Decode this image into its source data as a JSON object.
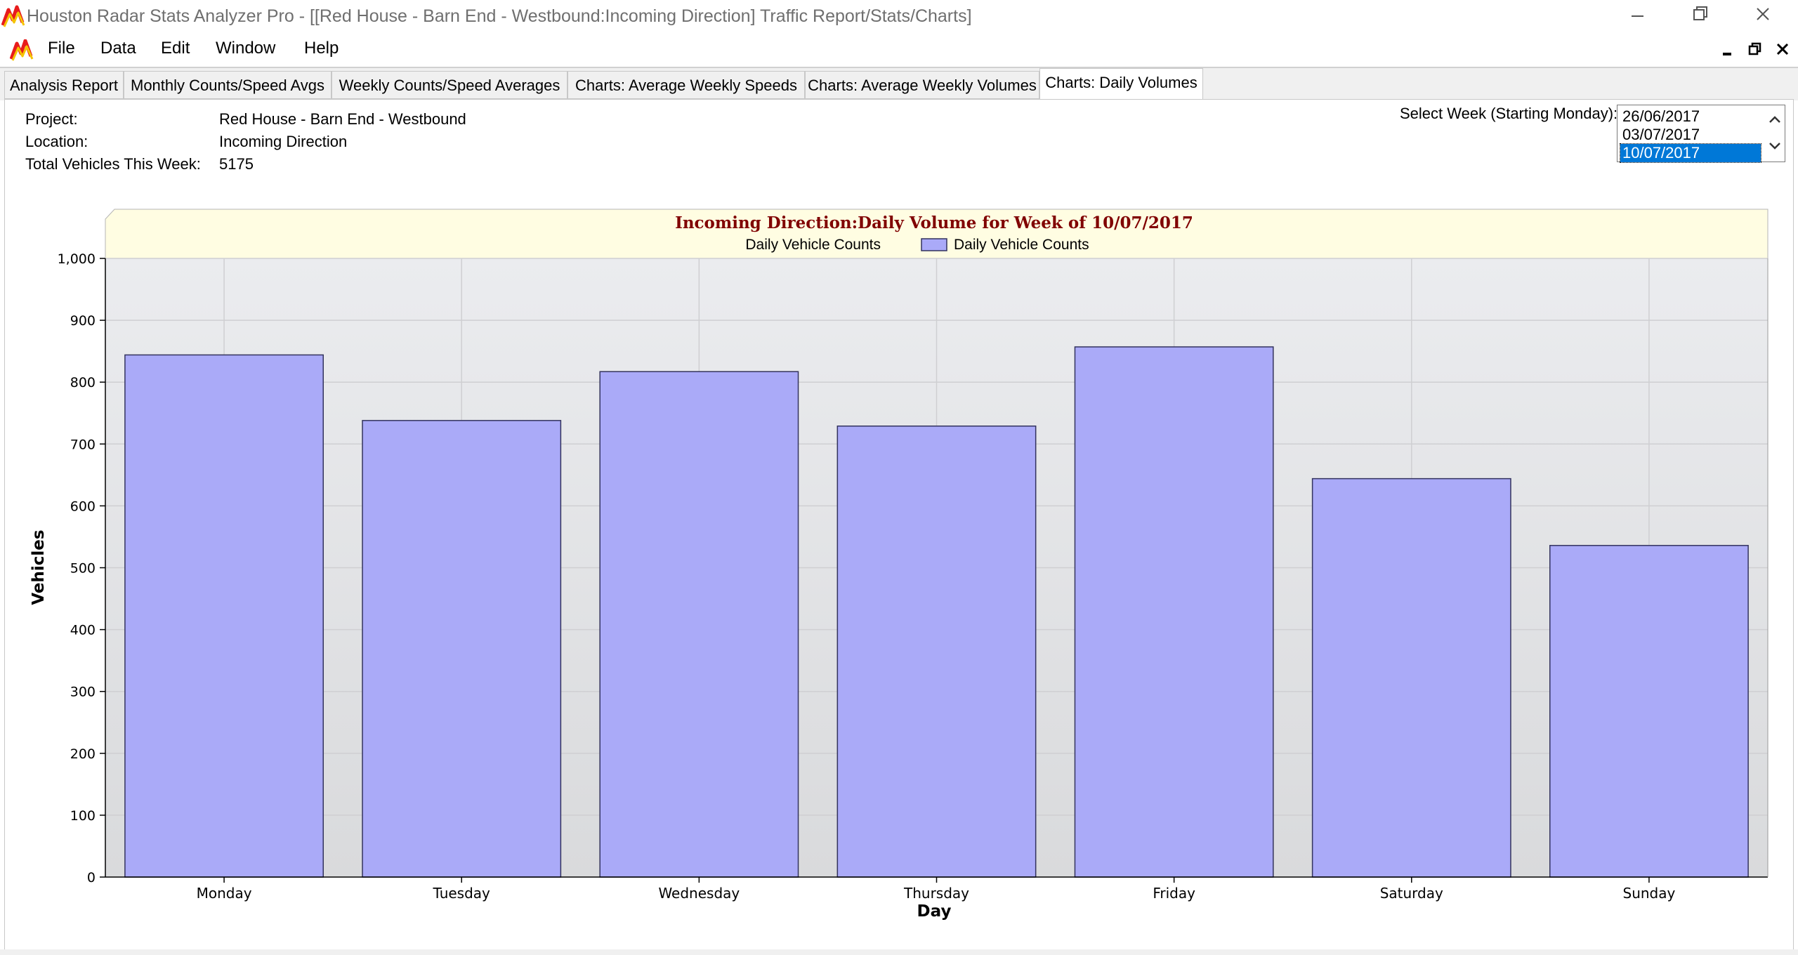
{
  "window": {
    "title": "Houston Radar Stats Analyzer Pro - [[Red House - Barn End - Westbound:Incoming Direction] Traffic Report/Stats/Charts]"
  },
  "menu": {
    "items": [
      "File",
      "Data",
      "Edit",
      "Window",
      "Help"
    ]
  },
  "tabs": [
    {
      "label": "Analysis Report",
      "active": false
    },
    {
      "label": "Monthly Counts/Speed Avgs",
      "active": false
    },
    {
      "label": "Weekly Counts/Speed Averages",
      "active": false
    },
    {
      "label": "Charts: Average Weekly Speeds",
      "active": false
    },
    {
      "label": "Charts: Average Weekly Volumes",
      "active": false
    },
    {
      "label": "Charts: Daily Volumes",
      "active": true
    }
  ],
  "info": {
    "project_label": "Project:",
    "project_value": "Red House - Barn End - Westbound",
    "location_label": "Location:",
    "location_value": "Incoming Direction",
    "total_label": "Total Vehicles This Week:",
    "total_value": "5175"
  },
  "week_selector": {
    "label": "Select Week (Starting Monday):",
    "options": [
      "26/06/2017",
      "03/07/2017",
      "10/07/2017"
    ],
    "selected": "10/07/2017"
  },
  "colors": {
    "bar_fill": "#aaaaf8",
    "bar_stroke": "#33335e",
    "plot_bg_top": "#ebecef",
    "plot_bg_bottom": "#d9dadc",
    "header_bg": "#fffde2",
    "title_color": "#800000",
    "selected_bg": "#0078d7"
  },
  "chart_data": {
    "type": "bar",
    "title": "Incoming Direction:Daily Volume for Week of 10/07/2017",
    "legend_label": "Daily Vehicle Counts",
    "legend_swatch_label": "Daily Vehicle Counts",
    "xlabel": "Day",
    "ylabel": "Vehicles",
    "categories": [
      "Monday",
      "Tuesday",
      "Wednesday",
      "Thursday",
      "Friday",
      "Saturday",
      "Sunday"
    ],
    "series": [
      {
        "name": "Daily Vehicle Counts",
        "values": [
          844,
          738,
          817,
          729,
          857,
          644,
          536
        ]
      }
    ],
    "ylim": [
      0,
      1000
    ],
    "yticks": [
      0,
      100,
      200,
      300,
      400,
      500,
      600,
      700,
      800,
      900,
      1000
    ],
    "ytick_labels": [
      "0",
      "100",
      "200",
      "300",
      "400",
      "500",
      "600",
      "700",
      "800",
      "900",
      "1,000"
    ],
    "grid": true,
    "legend_position": "top-center"
  }
}
